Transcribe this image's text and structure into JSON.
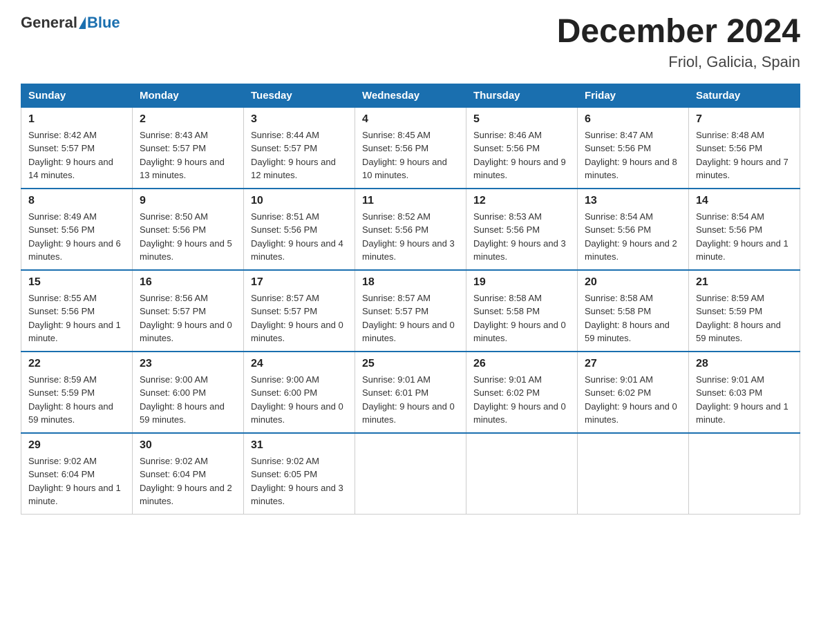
{
  "header": {
    "logo_general": "General",
    "logo_blue": "Blue",
    "month_title": "December 2024",
    "location": "Friol, Galicia, Spain"
  },
  "days_of_week": [
    "Sunday",
    "Monday",
    "Tuesday",
    "Wednesday",
    "Thursday",
    "Friday",
    "Saturday"
  ],
  "weeks": [
    [
      {
        "day": "1",
        "sunrise": "8:42 AM",
        "sunset": "5:57 PM",
        "daylight": "9 hours and 14 minutes."
      },
      {
        "day": "2",
        "sunrise": "8:43 AM",
        "sunset": "5:57 PM",
        "daylight": "9 hours and 13 minutes."
      },
      {
        "day": "3",
        "sunrise": "8:44 AM",
        "sunset": "5:57 PM",
        "daylight": "9 hours and 12 minutes."
      },
      {
        "day": "4",
        "sunrise": "8:45 AM",
        "sunset": "5:56 PM",
        "daylight": "9 hours and 10 minutes."
      },
      {
        "day": "5",
        "sunrise": "8:46 AM",
        "sunset": "5:56 PM",
        "daylight": "9 hours and 9 minutes."
      },
      {
        "day": "6",
        "sunrise": "8:47 AM",
        "sunset": "5:56 PM",
        "daylight": "9 hours and 8 minutes."
      },
      {
        "day": "7",
        "sunrise": "8:48 AM",
        "sunset": "5:56 PM",
        "daylight": "9 hours and 7 minutes."
      }
    ],
    [
      {
        "day": "8",
        "sunrise": "8:49 AM",
        "sunset": "5:56 PM",
        "daylight": "9 hours and 6 minutes."
      },
      {
        "day": "9",
        "sunrise": "8:50 AM",
        "sunset": "5:56 PM",
        "daylight": "9 hours and 5 minutes."
      },
      {
        "day": "10",
        "sunrise": "8:51 AM",
        "sunset": "5:56 PM",
        "daylight": "9 hours and 4 minutes."
      },
      {
        "day": "11",
        "sunrise": "8:52 AM",
        "sunset": "5:56 PM",
        "daylight": "9 hours and 3 minutes."
      },
      {
        "day": "12",
        "sunrise": "8:53 AM",
        "sunset": "5:56 PM",
        "daylight": "9 hours and 3 minutes."
      },
      {
        "day": "13",
        "sunrise": "8:54 AM",
        "sunset": "5:56 PM",
        "daylight": "9 hours and 2 minutes."
      },
      {
        "day": "14",
        "sunrise": "8:54 AM",
        "sunset": "5:56 PM",
        "daylight": "9 hours and 1 minute."
      }
    ],
    [
      {
        "day": "15",
        "sunrise": "8:55 AM",
        "sunset": "5:56 PM",
        "daylight": "9 hours and 1 minute."
      },
      {
        "day": "16",
        "sunrise": "8:56 AM",
        "sunset": "5:57 PM",
        "daylight": "9 hours and 0 minutes."
      },
      {
        "day": "17",
        "sunrise": "8:57 AM",
        "sunset": "5:57 PM",
        "daylight": "9 hours and 0 minutes."
      },
      {
        "day": "18",
        "sunrise": "8:57 AM",
        "sunset": "5:57 PM",
        "daylight": "9 hours and 0 minutes."
      },
      {
        "day": "19",
        "sunrise": "8:58 AM",
        "sunset": "5:58 PM",
        "daylight": "9 hours and 0 minutes."
      },
      {
        "day": "20",
        "sunrise": "8:58 AM",
        "sunset": "5:58 PM",
        "daylight": "8 hours and 59 minutes."
      },
      {
        "day": "21",
        "sunrise": "8:59 AM",
        "sunset": "5:59 PM",
        "daylight": "8 hours and 59 minutes."
      }
    ],
    [
      {
        "day": "22",
        "sunrise": "8:59 AM",
        "sunset": "5:59 PM",
        "daylight": "8 hours and 59 minutes."
      },
      {
        "day": "23",
        "sunrise": "9:00 AM",
        "sunset": "6:00 PM",
        "daylight": "8 hours and 59 minutes."
      },
      {
        "day": "24",
        "sunrise": "9:00 AM",
        "sunset": "6:00 PM",
        "daylight": "9 hours and 0 minutes."
      },
      {
        "day": "25",
        "sunrise": "9:01 AM",
        "sunset": "6:01 PM",
        "daylight": "9 hours and 0 minutes."
      },
      {
        "day": "26",
        "sunrise": "9:01 AM",
        "sunset": "6:02 PM",
        "daylight": "9 hours and 0 minutes."
      },
      {
        "day": "27",
        "sunrise": "9:01 AM",
        "sunset": "6:02 PM",
        "daylight": "9 hours and 0 minutes."
      },
      {
        "day": "28",
        "sunrise": "9:01 AM",
        "sunset": "6:03 PM",
        "daylight": "9 hours and 1 minute."
      }
    ],
    [
      {
        "day": "29",
        "sunrise": "9:02 AM",
        "sunset": "6:04 PM",
        "daylight": "9 hours and 1 minute."
      },
      {
        "day": "30",
        "sunrise": "9:02 AM",
        "sunset": "6:04 PM",
        "daylight": "9 hours and 2 minutes."
      },
      {
        "day": "31",
        "sunrise": "9:02 AM",
        "sunset": "6:05 PM",
        "daylight": "9 hours and 3 minutes."
      },
      null,
      null,
      null,
      null
    ]
  ]
}
